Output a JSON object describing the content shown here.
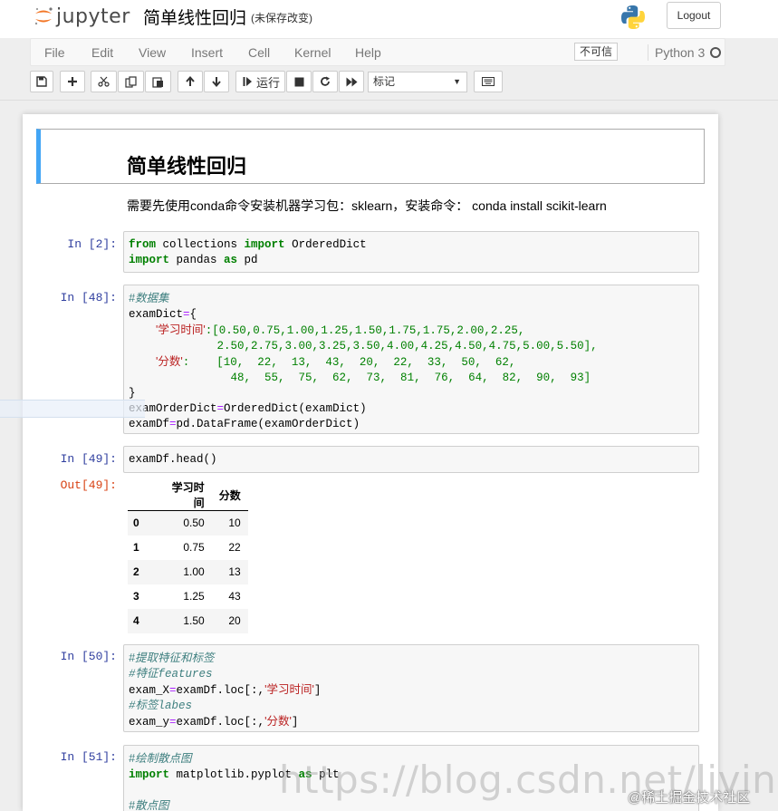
{
  "header": {
    "logo_text": "jupyter",
    "notebook_title": "简单线性回归",
    "save_status": "(未保存改变)",
    "logout_label": "Logout"
  },
  "menu": {
    "items": [
      "File",
      "Edit",
      "View",
      "Insert",
      "Cell",
      "Kernel",
      "Help"
    ],
    "trusted_label": "不可信",
    "kernel_name": "Python 3"
  },
  "toolbar": {
    "run_label": "运行",
    "cell_type": "标记"
  },
  "markdown": {
    "heading": "简单线性回归",
    "text": "需要先使用conda命令安装机器学习包：sklearn，安装命令： conda install scikit-learn"
  },
  "cells": {
    "c1": {
      "prompt": "In [2]:"
    },
    "c2": {
      "prompt": "In [48]:"
    },
    "c3": {
      "prompt": "In [49]:",
      "out_prompt": "Out[49]:"
    },
    "c4": {
      "prompt": "In [50]:"
    },
    "c5": {
      "prompt": "In [51]:"
    }
  },
  "code": {
    "c1_l1": [
      "from",
      " collections ",
      "import",
      " OrderedDict"
    ],
    "c1_l2": [
      "import",
      " pandas ",
      "as",
      " pd"
    ],
    "c2_comment": "#数据集",
    "c2_l2": [
      "examDict",
      "=",
      "{"
    ],
    "c2_key1": "'学习时间'",
    "c2_vals1": ":[0.50,0.75,1.00,1.25,1.50,1.75,1.75,2.00,2.25,",
    "c2_vals2": "2.50,2.75,3.00,3.25,3.50,4.00,4.25,4.50,4.75,5.00,5.50],",
    "c2_key2": "'分数'",
    "c2_vals3": ":    [10,  22,  13,  43,  20,  22,  33,  50,  62,",
    "c2_vals4": "48,  55,  75,  62,  73,  81,  76,  64,  82,  90,  93]",
    "c2_close": "}",
    "c2_l9": [
      "examOrderDict",
      "=",
      "OrderedDict(examDict)"
    ],
    "c2_l10": [
      "examDf",
      "=",
      "pd.DataFrame(examOrderDict)"
    ],
    "c3_l1": "examDf.head()",
    "c4_c1": "#提取特征和标签",
    "c4_c2": "#特征features",
    "c4_l3": [
      "exam_X",
      "=",
      "examDf.loc[:,",
      "'学习时间'",
      "]"
    ],
    "c4_c4": "#标签labes",
    "c4_l5": [
      "exam_y",
      "=",
      "examDf.loc[:,",
      "'分数'",
      "]"
    ],
    "c5_c1": "#绘制散点图",
    "c5_l2": [
      "import",
      " matplotlib.pyplot ",
      "as",
      " plt"
    ],
    "c5_c3": "#散点图"
  },
  "output_table": {
    "headers": [
      "",
      "学习时间",
      "分数"
    ],
    "rows": [
      [
        "0",
        "0.50",
        "10"
      ],
      [
        "1",
        "0.75",
        "22"
      ],
      [
        "2",
        "1.00",
        "13"
      ],
      [
        "3",
        "1.25",
        "43"
      ],
      [
        "4",
        "1.50",
        "20"
      ]
    ]
  },
  "watermark": {
    "url": "https://blog.csdn.net/livingbody",
    "brand": "@稀土掘金技术社区"
  },
  "colors": {
    "keyword": "#008000",
    "string": "#ba2121",
    "comment": "#408080",
    "operator": "#aa22ff",
    "in_prompt": "#303f9f",
    "out_prompt": "#d84315",
    "selected_cell_bar": "#42a5f5"
  }
}
